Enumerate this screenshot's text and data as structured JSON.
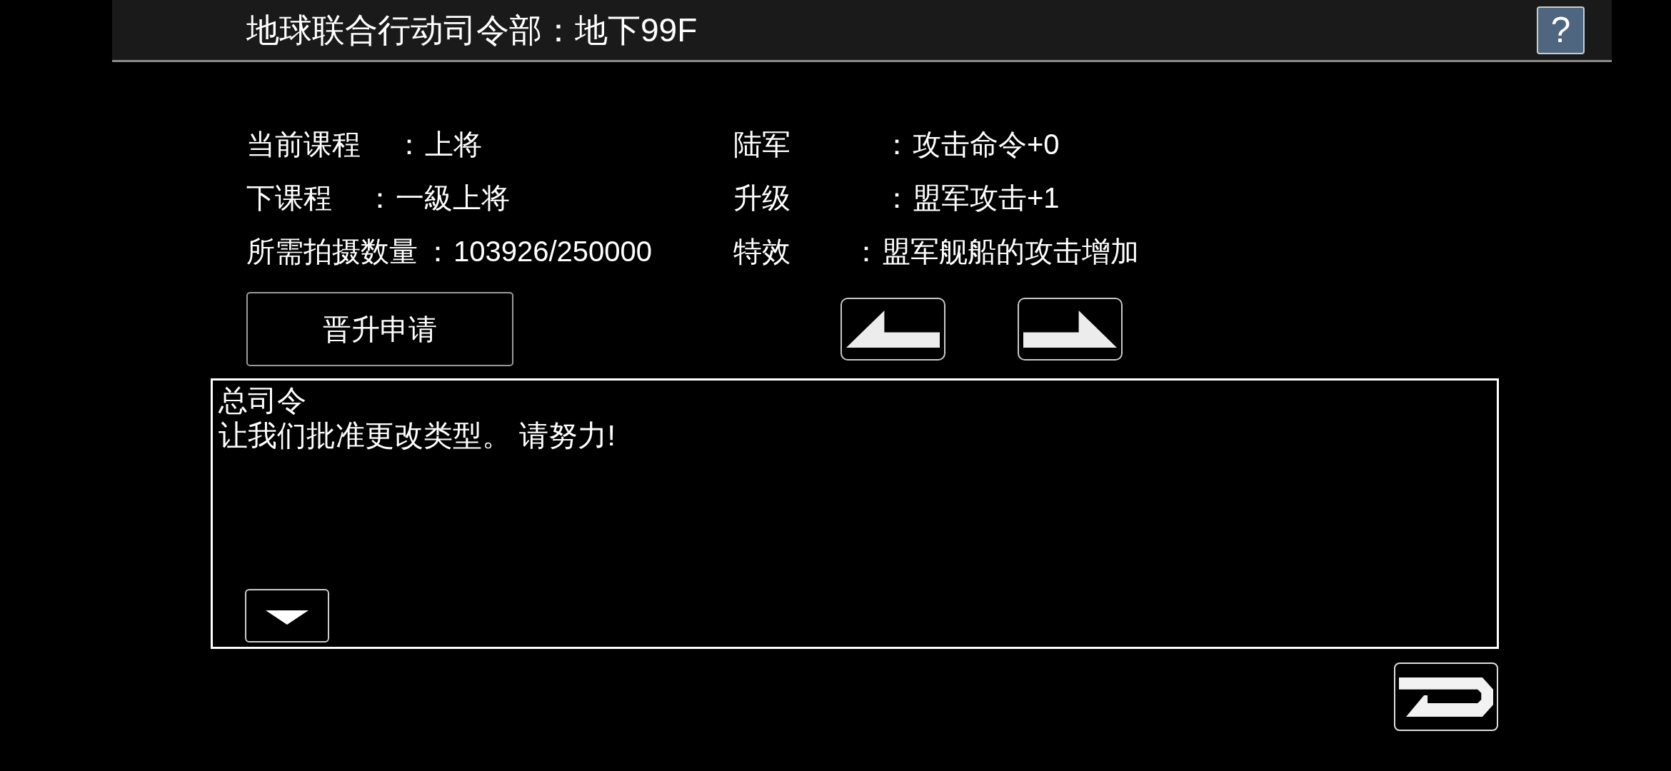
{
  "header": {
    "title": "地球联合行动司令部：地下99F",
    "help_button": "?"
  },
  "info": {
    "left_column": [
      {
        "label": "当前课程",
        "separator": "：",
        "value": "上将"
      },
      {
        "label": "下课程",
        "separator": "：",
        "value": "一級上将"
      },
      {
        "label": "所需拍摄数量",
        "separator": "：",
        "value": "103926/250000"
      }
    ],
    "right_column": [
      {
        "label": "陆军",
        "separator": "：",
        "value": "攻击命令+0"
      },
      {
        "label": "升级",
        "separator": "：",
        "value": "盟军攻击+1"
      },
      {
        "label": "特效",
        "separator": "：",
        "value": "盟军舰船的攻击增加"
      }
    ]
  },
  "actions": {
    "promote_button": "晋升申请"
  },
  "message": {
    "speaker": "总司令",
    "text": "让我们批准更改类型。 请努力!"
  }
}
